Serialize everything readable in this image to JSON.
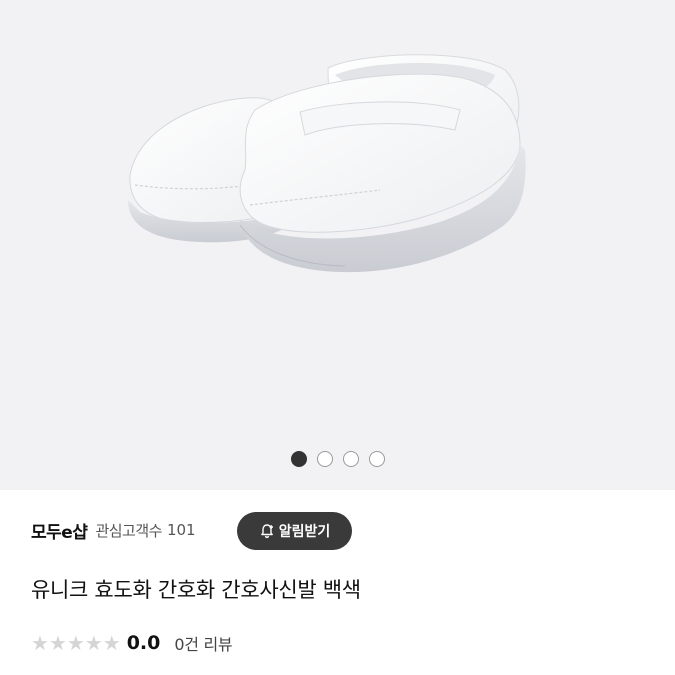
{
  "gallery": {
    "image_alt": "white nurse shoes",
    "dots_total": 4,
    "active_index": 0
  },
  "seller": {
    "name": "모두e샵",
    "fan_label": "관심고객수",
    "fan_count": "101"
  },
  "alarm_button": {
    "label": "알림받기",
    "icon": "bell-plus-icon"
  },
  "product": {
    "title": "유니크 효도화 간호화 간호사신발 백색"
  },
  "rating": {
    "stars": 0,
    "max_stars": 5,
    "value": "0.0",
    "review_text": "0건 리뷰"
  },
  "colors": {
    "gallery_bg": "#f2f2f4",
    "button_bg": "#3a3a3a",
    "star_empty": "#d5d5d5"
  }
}
